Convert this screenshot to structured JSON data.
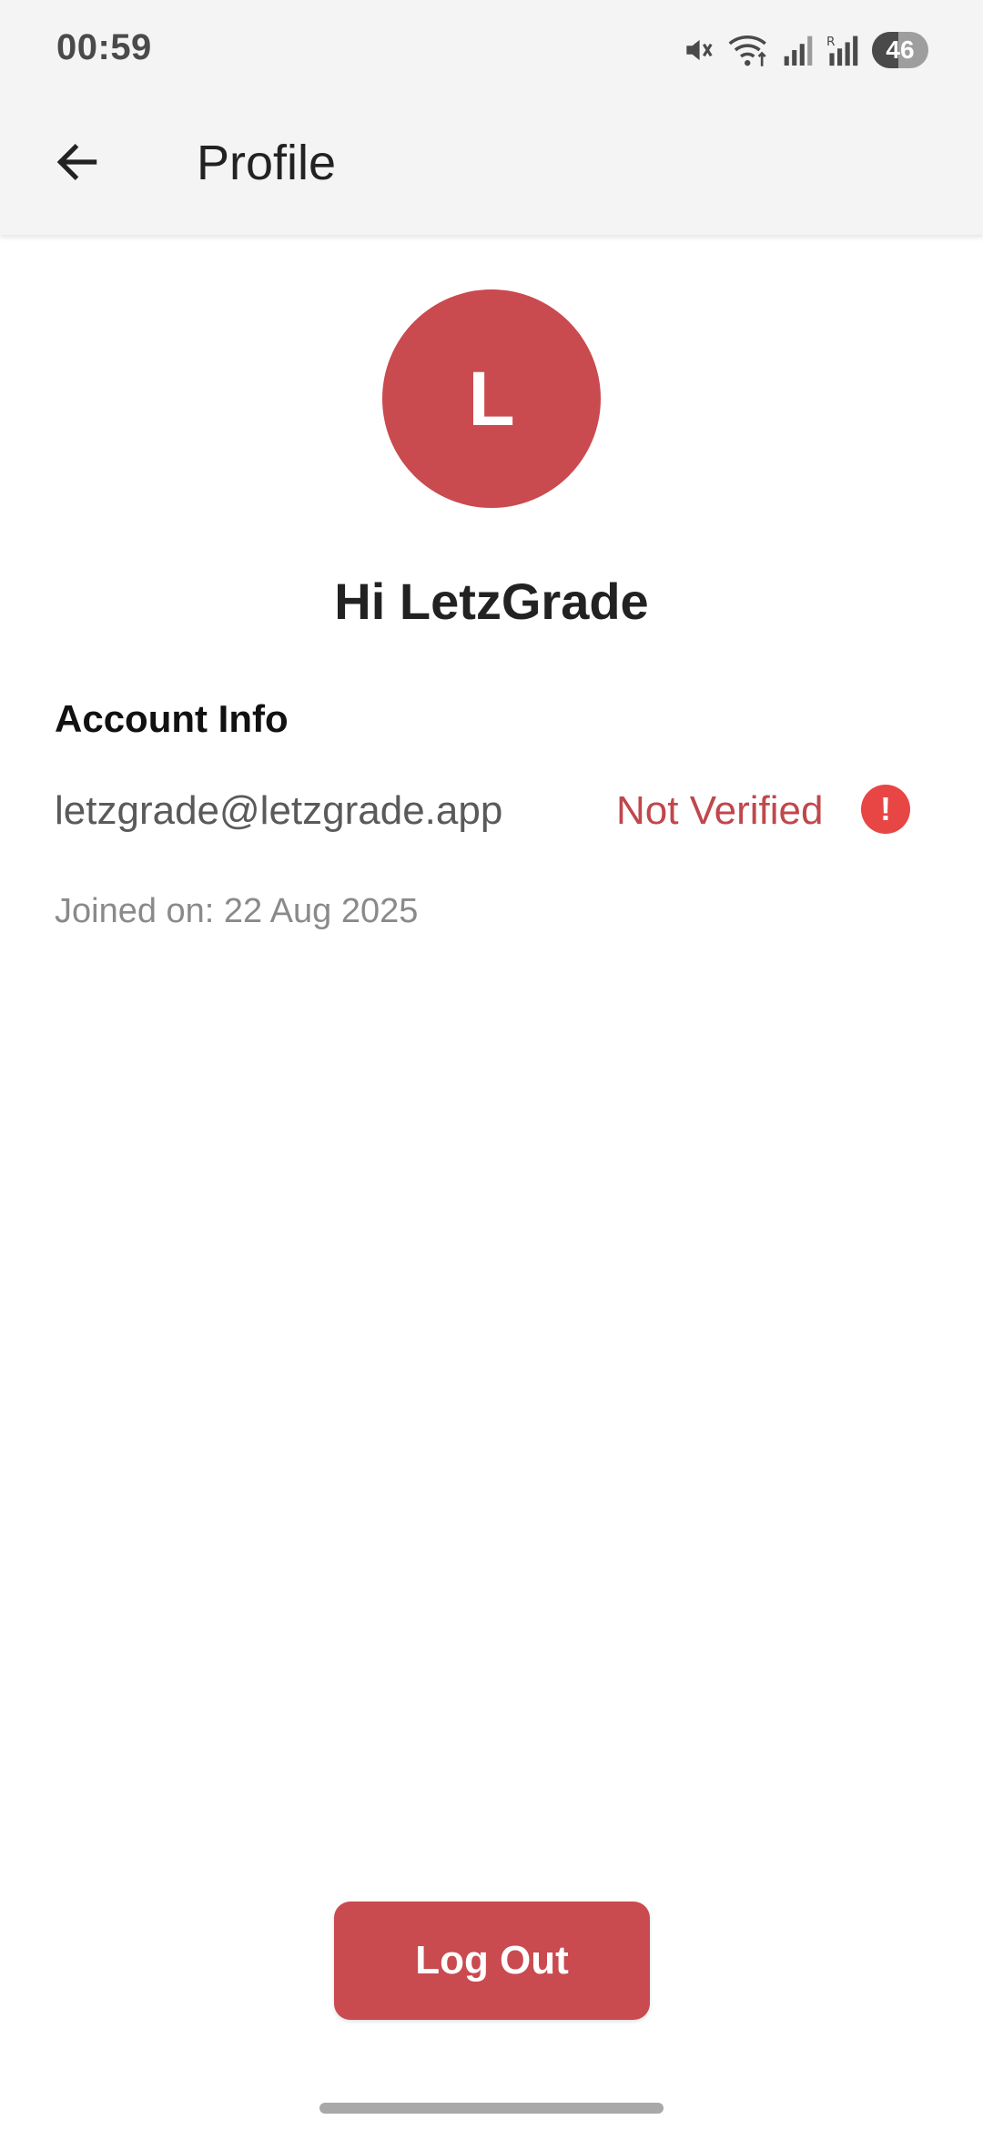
{
  "status_bar": {
    "time": "00:59",
    "icons": [
      "mute-icon",
      "wifi-icon",
      "signal-icon",
      "signal-roaming-icon",
      "battery-icon"
    ],
    "battery_level": "46",
    "battery_fraction": 0.46
  },
  "app_bar": {
    "title": "Profile",
    "back_icon": "arrow-left-icon"
  },
  "profile": {
    "avatar_letter": "L",
    "avatar_color": "#c94a4f",
    "greeting": "Hi LetzGrade"
  },
  "account_info": {
    "section_title": "Account Info",
    "email": "letzgrade@letzgrade.app",
    "verification_status": "Not Verified",
    "verification_color": "#c0474c",
    "alert_icon": "alert-circle-icon",
    "joined": "Joined on: 22 Aug 2025"
  },
  "actions": {
    "logout_label": "Log Out",
    "logout_color": "#c94a4f"
  }
}
